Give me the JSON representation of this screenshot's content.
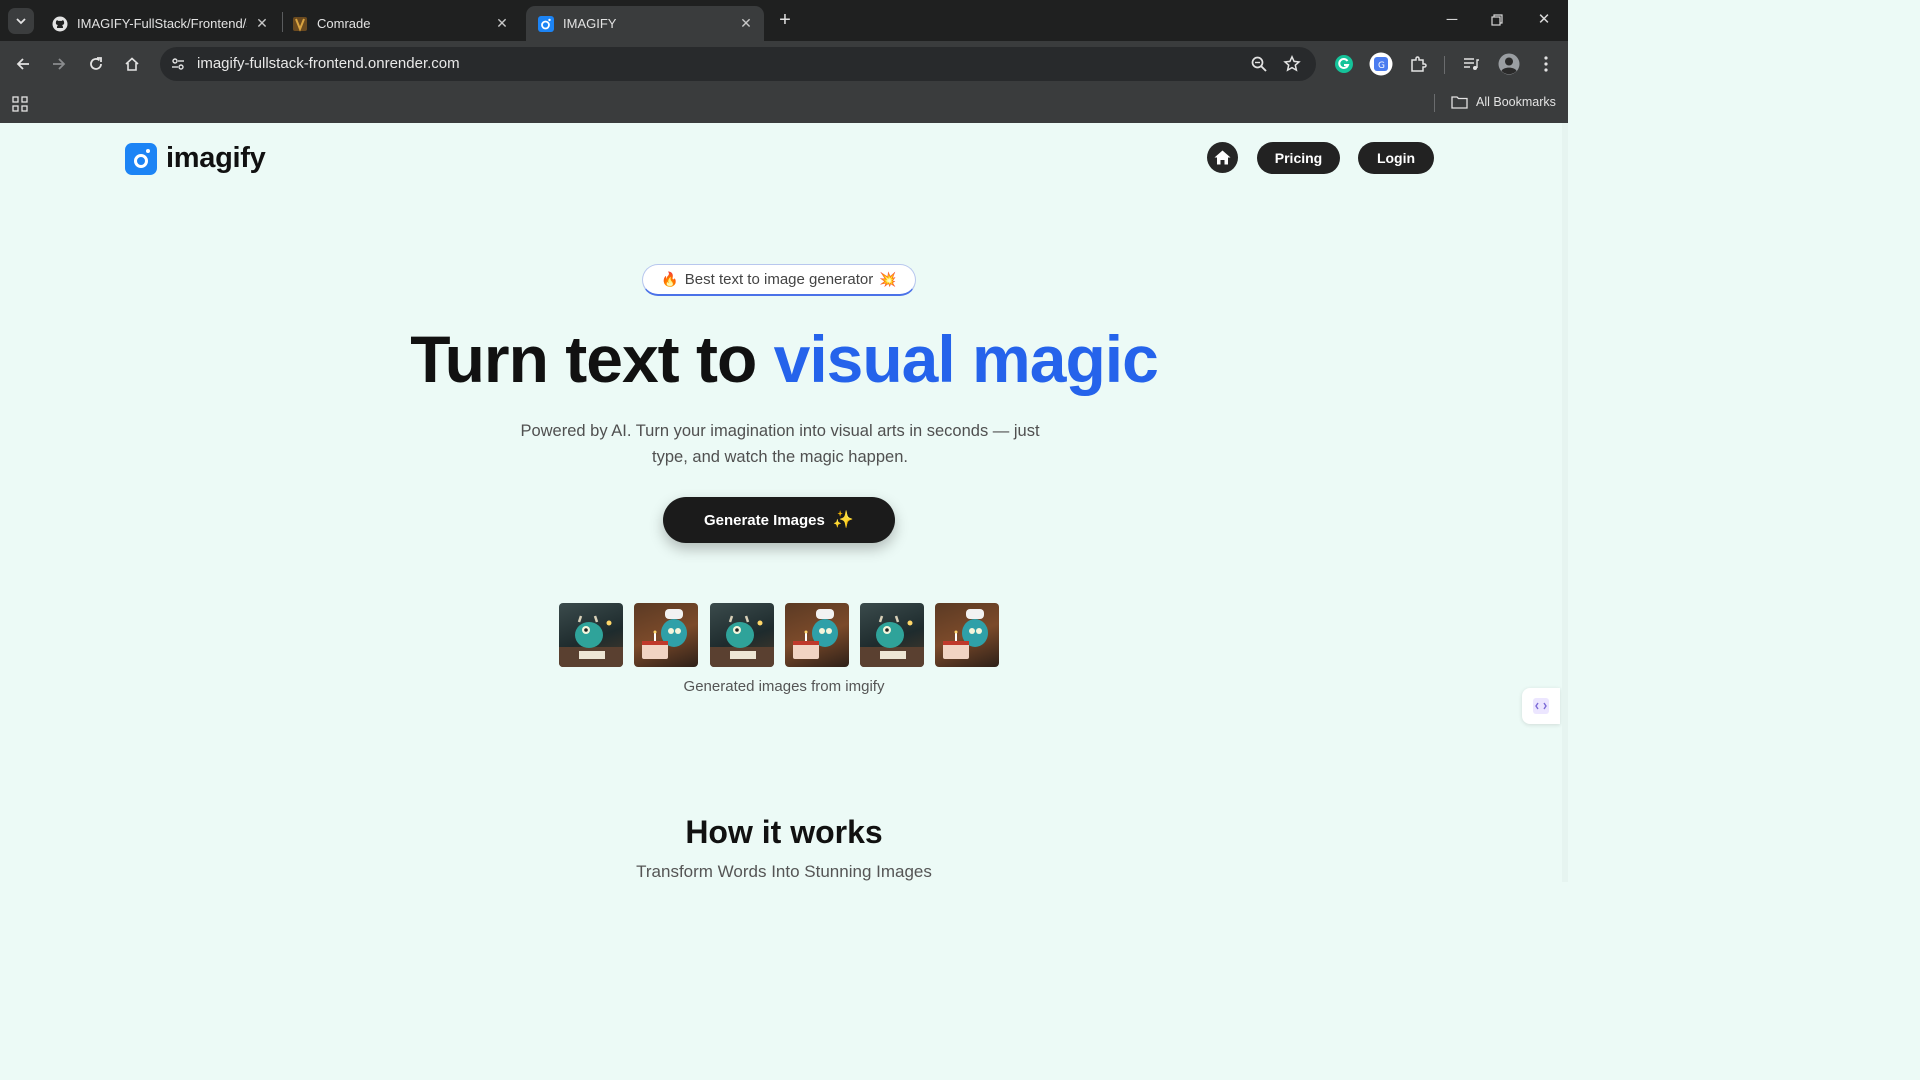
{
  "browser": {
    "tabs": [
      {
        "title": "IMAGIFY-FullStack/Frontend/src",
        "favicon": "github-icon",
        "active": false
      },
      {
        "title": "Comrade",
        "favicon": "comrade-icon",
        "active": false
      },
      {
        "title": "IMAGIFY",
        "favicon": "imagify-icon",
        "active": true
      }
    ],
    "url": "imagify-fullstack-frontend.onrender.com",
    "bookmarks_label": "All Bookmarks"
  },
  "page": {
    "brand": "imagify",
    "nav": {
      "pricing_label": "Pricing",
      "login_label": "Login"
    },
    "hero": {
      "badge_text": "Best text to image generator",
      "badge_left_emoji": "🔥",
      "badge_right_emoji": "💥",
      "headline_plain": "Turn text to",
      "headline_accent": "visual magic",
      "subtitle": "Powered by AI. Turn your imagination into visual arts in seconds — just type, and watch the magic happen.",
      "cta_label": "Generate Images",
      "cta_icon": "sparkles-icon",
      "thumbnails_caption": "Generated images from imgify"
    },
    "how_it_works": {
      "title": "How it works",
      "subtitle": "Transform Words Into Stunning Images"
    }
  },
  "colors": {
    "accent": "#2563eb",
    "brand": "#1c84f5",
    "page_bg": "#ecfaf6",
    "dark_button": "#222222"
  }
}
